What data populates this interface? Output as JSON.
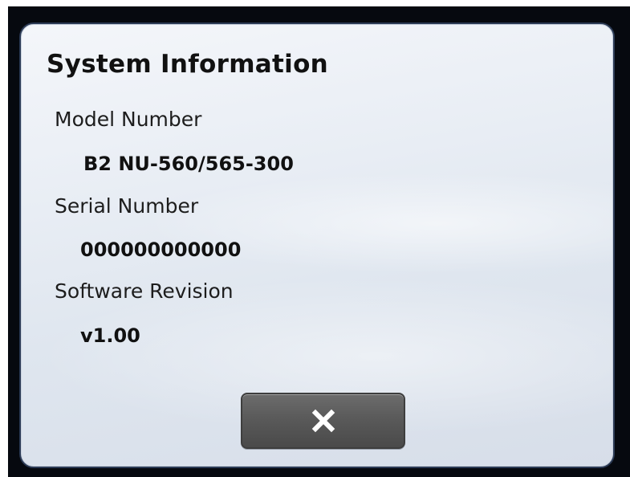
{
  "dialog": {
    "title": "System Information",
    "fields": [
      {
        "label": "Model Number",
        "value": "B2 NU-560/565-300"
      },
      {
        "label": "Serial Number",
        "value": "000000000000"
      },
      {
        "label": "Software Revision",
        "value": "v1.00"
      }
    ],
    "close_button": {
      "icon": "close-icon"
    }
  },
  "colors": {
    "screen_border": "#06090f",
    "dialog_border": "#2b3a55",
    "button_fill": "#5a5a5a",
    "button_icon": "#ffffff"
  }
}
